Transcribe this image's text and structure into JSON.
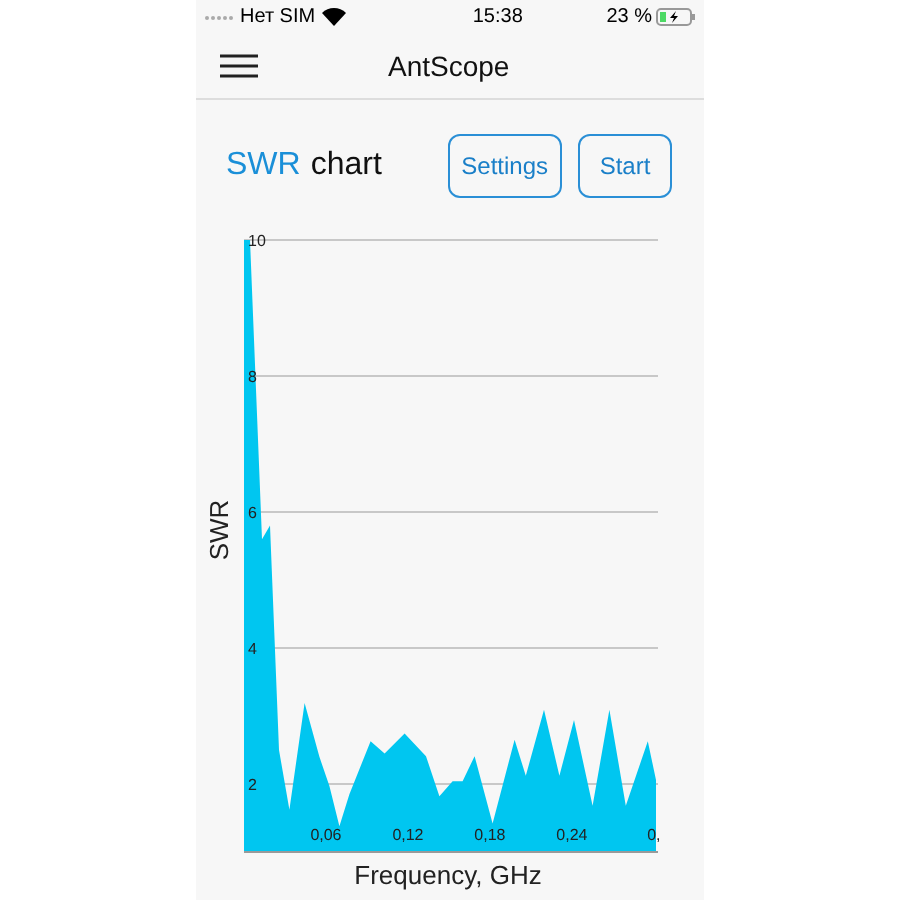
{
  "status_bar": {
    "carrier": "Нет SIM",
    "time": "15:38",
    "battery": "23 %"
  },
  "nav_bar": {
    "title": "AntScope"
  },
  "header": {
    "title_accent": "SWR",
    "title_rest": "chart",
    "buttons": [
      "Settings",
      "Start"
    ]
  },
  "chart_data": {
    "type": "area",
    "xlabel": "Frequency, GHz",
    "ylabel": "SWR",
    "x": [
      0,
      0.0044,
      0.0132,
      0.019,
      0.0256,
      0.0332,
      0.0443,
      0.0552,
      0.0625,
      0.0698,
      0.0771,
      0.0926,
      0.1029,
      0.1175,
      0.1332,
      0.143,
      0.1526,
      0.16,
      0.1687,
      0.1819,
      0.198,
      0.2063,
      0.2195,
      0.2308,
      0.2415,
      0.2551,
      0.2674,
      0.2795,
      0.2956,
      0.3015
    ],
    "series": [
      {
        "color": "#00c6f0",
        "values": [
          10,
          10,
          5.6,
          5.8,
          2.5,
          1.62,
          3.19,
          2.4,
          1.97,
          1.38,
          1.85,
          2.63,
          2.45,
          2.74,
          2.41,
          1.82,
          2.04,
          2.04,
          2.41,
          1.42,
          2.65,
          2.12,
          3.09,
          2.12,
          2.94,
          1.68,
          3.09,
          1.68,
          2.63,
          2.06
        ]
      }
    ],
    "xlim": [
      0,
      0.303
    ],
    "ylim": [
      1,
      10
    ],
    "grid": true,
    "xticks": [
      {
        "value": 0.06,
        "label": "0,06"
      },
      {
        "value": 0.12,
        "label": "0,12"
      },
      {
        "value": 0.18,
        "label": "0,18"
      },
      {
        "value": 0.24,
        "label": "0,24"
      },
      {
        "value": 0.3,
        "label": "0,"
      }
    ],
    "yticks": [
      2,
      4,
      6,
      8,
      10
    ]
  }
}
